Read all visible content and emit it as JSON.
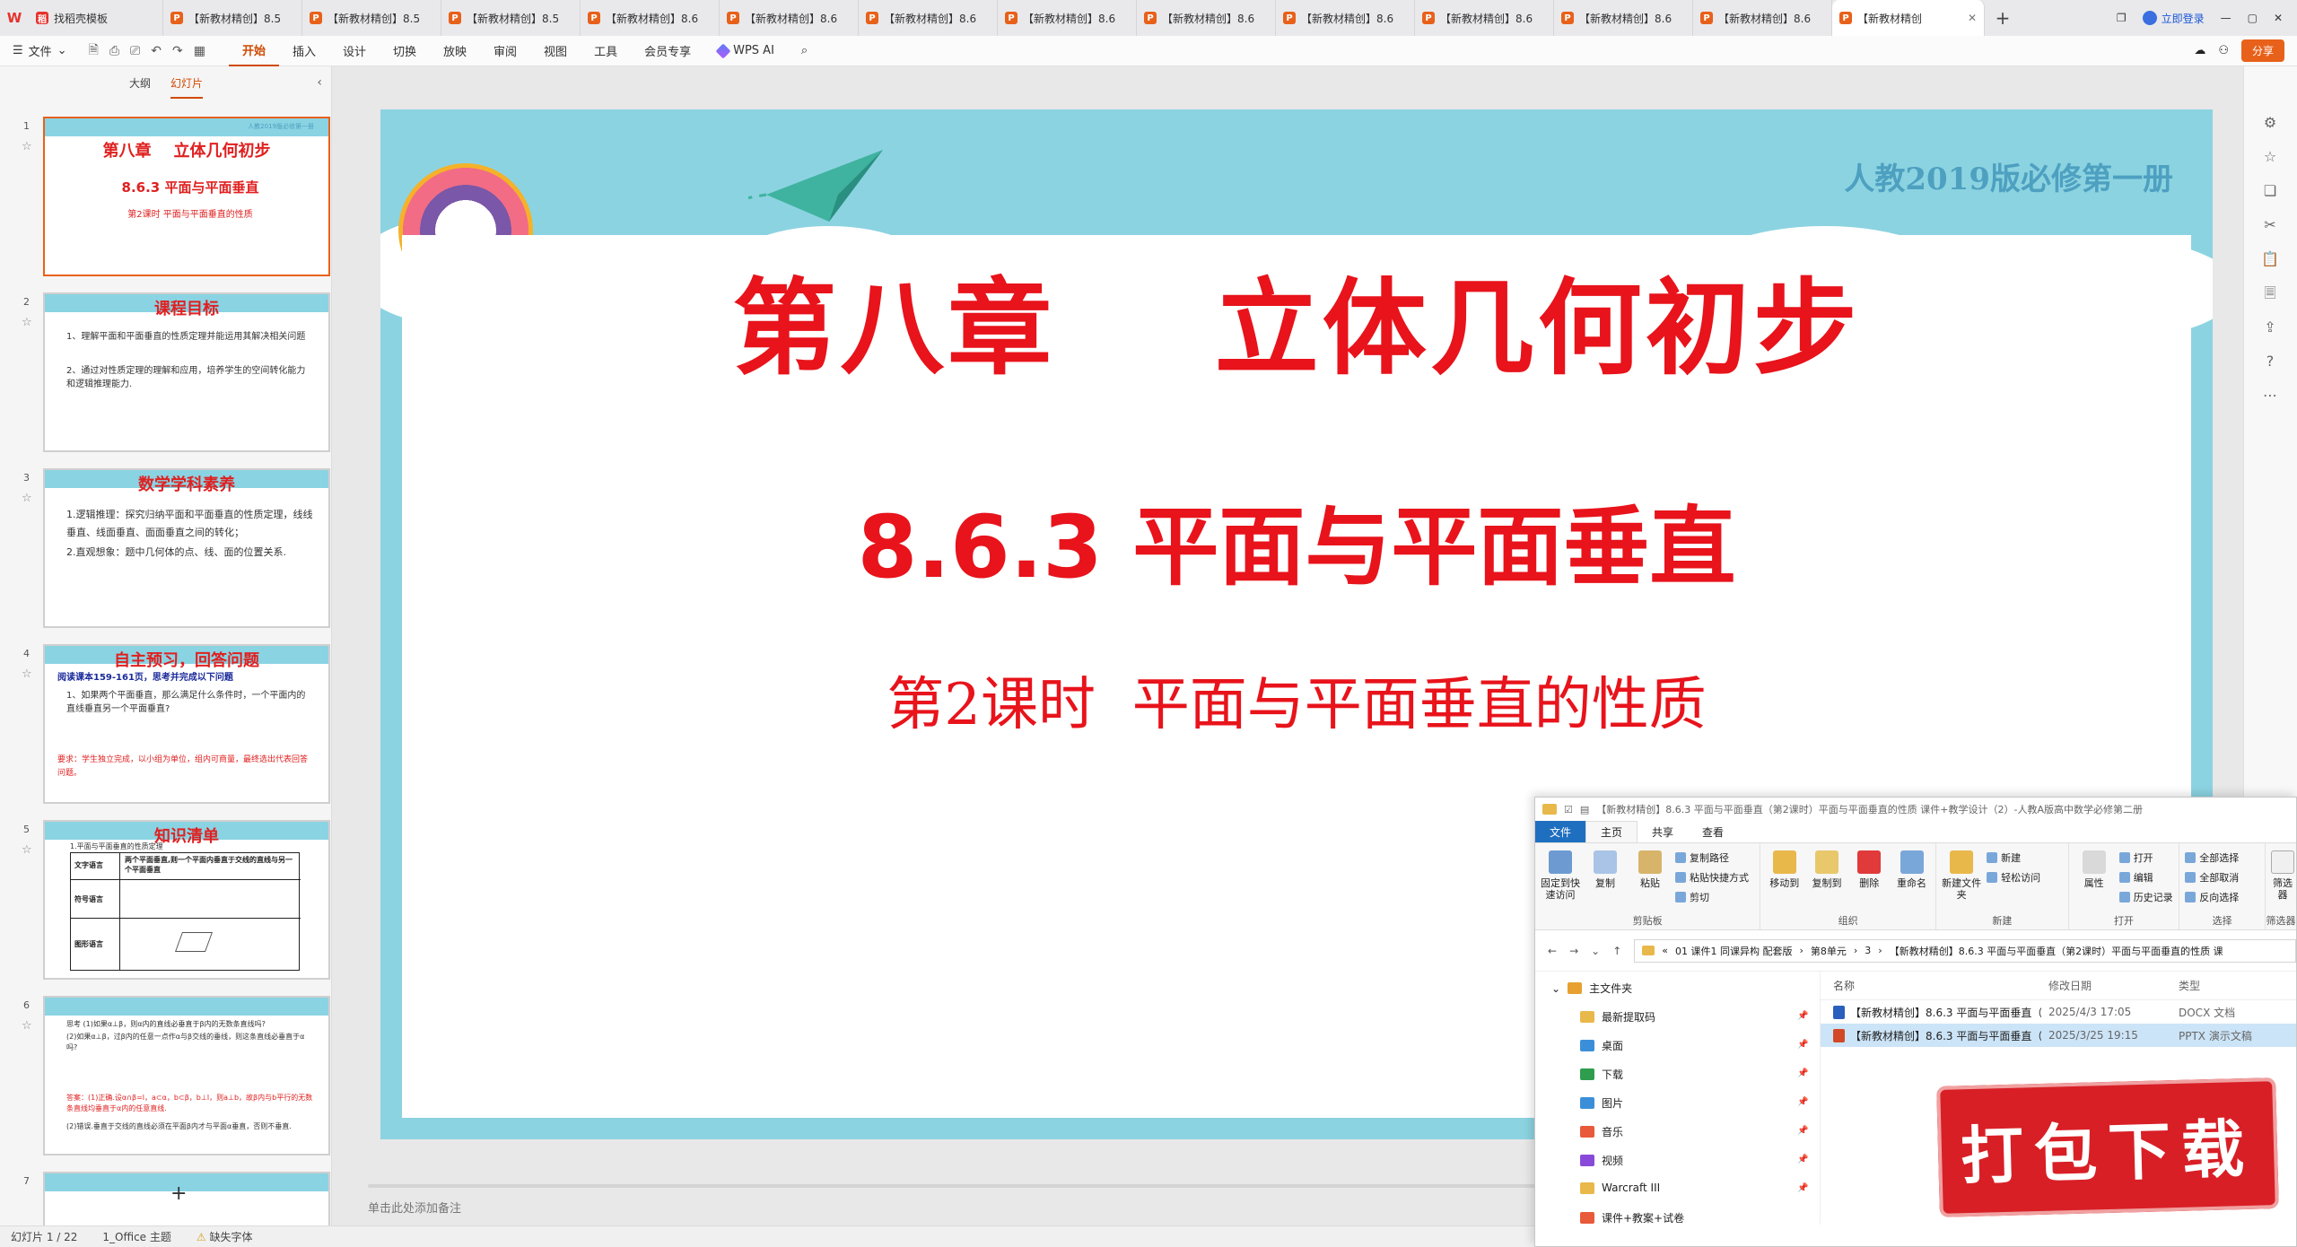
{
  "tabbar": {
    "tabs": [
      {
        "label": "找稻壳模板",
        "icon": "z"
      },
      {
        "label": "【新教材精创】8.5",
        "icon": "p"
      },
      {
        "label": "【新教材精创】8.5",
        "icon": "p"
      },
      {
        "label": "【新教材精创】8.5",
        "icon": "p"
      },
      {
        "label": "【新教材精创】8.6",
        "icon": "p"
      },
      {
        "label": "【新教材精创】8.6",
        "icon": "p"
      },
      {
        "label": "【新教材精创】8.6",
        "icon": "p"
      },
      {
        "label": "【新教材精创】8.6",
        "icon": "p"
      },
      {
        "label": "【新教材精创】8.6",
        "icon": "p"
      },
      {
        "label": "【新教材精创】8.6",
        "icon": "p"
      },
      {
        "label": "【新教材精创】8.6",
        "icon": "p"
      },
      {
        "label": "【新教材精创】8.6",
        "icon": "p"
      },
      {
        "label": "【新教材精创】8.6",
        "icon": "p"
      }
    ],
    "active_tab": "【新教材精创",
    "login": "立即登录"
  },
  "toolbar": {
    "file": "文件",
    "menu": [
      "开始",
      "插入",
      "设计",
      "切换",
      "放映",
      "审阅",
      "视图",
      "工具",
      "会员专享"
    ],
    "wps_ai": "WPS AI",
    "share": "分享"
  },
  "thumbs": {
    "outline": "大纲",
    "slides": "幻灯片",
    "s1": {
      "num": "1",
      "title": "第八章    立体几何初步",
      "sub": "8.6.3 平面与平面垂直",
      "sub2": "第2课时  平面与平面垂直的性质",
      "corner": "人教2019版必修第一册"
    },
    "s2": {
      "num": "2",
      "title": "课程目标",
      "l1": "1、理解平面和平面垂直的性质定理并能运用其解决相关问题",
      "l2": "2、通过对性质定理的理解和应用，培养学生的空间转化能力和逻辑推理能力."
    },
    "s3": {
      "num": "3",
      "title": "数学学科素养",
      "l1": "1.逻辑推理：探究归纳平面和平面垂直的性质定理，线线垂直、线面垂直、面面垂直之间的转化；",
      "l2": "2.直观想象：题中几何体的点、线、面的位置关系."
    },
    "s4": {
      "num": "4",
      "title": "自主预习，回答问题",
      "l1": "阅读课本159-161页，思考并完成以下问题",
      "l2": "1、如果两个平面垂直，那么满足什么条件时，一个平面内的直线垂直另一个平面垂直?",
      "l3": "要求：学生独立完成，以小组为单位，组内可商量，最终选出代表回答问题。"
    },
    "s5": {
      "num": "5",
      "title": "知识清单",
      "l1": "1.平面与平面垂直的性质定理",
      "r1": "文字语言",
      "r1v": "两个平面垂直,则一个平面内垂直于交线的直线与另一个平面垂直",
      "r2": "符号语言",
      "r3": "图形语言"
    },
    "s6": {
      "num": "6",
      "l1": "思考 (1)如果α⊥β，则α内的直线必垂直于β内的无数条直线吗?",
      "l2": "(2)如果α⊥β，过β内的任意一点作α与β交线的垂线，则这条直线必垂直于α吗?",
      "l3": "答案：(1)正确.设α∩β=l，a⊂α，b⊂β，b⊥l，则a⊥b，故β内与b平行的无数条直线均垂直于α内的任意直线.",
      "l4": "(2)错误.垂直于交线的直线必须在平面β内才与平面α垂直，否则不垂直."
    },
    "s7": {
      "num": "7"
    }
  },
  "slide": {
    "publisher": "人教2019版必修第一册",
    "chapter": "第八章    立体几何初步",
    "section": "8.6.3 平面与平面垂直",
    "lesson": "第2课时  平面与平面垂直的性质",
    "notes_placeholder": "单击此处添加备注"
  },
  "status": {
    "slide_count": "幻灯片 1 / 22",
    "theme": "1_Office 主题",
    "missing_font": "缺失字体"
  },
  "explorer": {
    "title": "【新教材精创】8.6.3 平面与平面垂直（第2课时）平面与平面垂直的性质 课件+教学设计（2）-人教A版高中数学必修第二册",
    "tabs": [
      "文件",
      "主页",
      "共享",
      "查看"
    ],
    "ribbon": {
      "pin": "固定到快速访问",
      "copy": "复制",
      "paste": "粘贴",
      "copy_path": "复制路径",
      "paste_shortcut": "粘贴快捷方式",
      "cut": "剪切",
      "clipboard": "剪贴板",
      "move_to": "移动到",
      "copy_to": "复制到",
      "delete": "删除",
      "rename": "重命名",
      "organize": "组织",
      "new_folder": "新建文件夹",
      "new_item": "新建",
      "easy_access": "轻松访问",
      "new_group": "新建",
      "properties": "属性",
      "open": "打开",
      "edit": "编辑",
      "history": "历史记录",
      "open_group": "打开",
      "select_all": "全部选择",
      "select_none": "全部取消",
      "invert": "反向选择",
      "select_group": "选择",
      "filter": "筛选器",
      "filter_group": "筛选器"
    },
    "address": [
      "01 课件1 同课异构 配套版",
      "第8单元",
      "3",
      "【新教材精创】8.6.3 平面与平面垂直（第2课时）平面与平面垂直的性质 课"
    ],
    "tree": [
      {
        "label": "主文件夹",
        "root": true
      },
      {
        "label": "最新提取码",
        "color": "#e8b84a"
      },
      {
        "label": "桌面",
        "color": "#3b8fd9"
      },
      {
        "label": "下载",
        "color": "#2e9d4e"
      },
      {
        "label": "图片",
        "color": "#3b8fd9"
      },
      {
        "label": "音乐",
        "color": "#e85a3a"
      },
      {
        "label": "视频",
        "color": "#8a4ad9"
      },
      {
        "label": "Warcraft III",
        "color": "#e8b84a"
      },
      {
        "label": "课件+教案+试卷",
        "color": "#e85a3a"
      }
    ],
    "columns": [
      "名称",
      "修改日期",
      "类型"
    ],
    "files": [
      {
        "name": "【新教材精创】8.6.3 平面与平面垂直（...",
        "date": "2025/4/3 17:05",
        "type": "DOCX 文档",
        "color": "#2b5fbe"
      },
      {
        "name": "【新教材精创】8.6.3 平面与平面垂直（...",
        "date": "2025/3/25 19:15",
        "type": "PPTX 演示文稿",
        "color": "#d24726"
      }
    ]
  },
  "stamp": {
    "label": "打包下载"
  }
}
